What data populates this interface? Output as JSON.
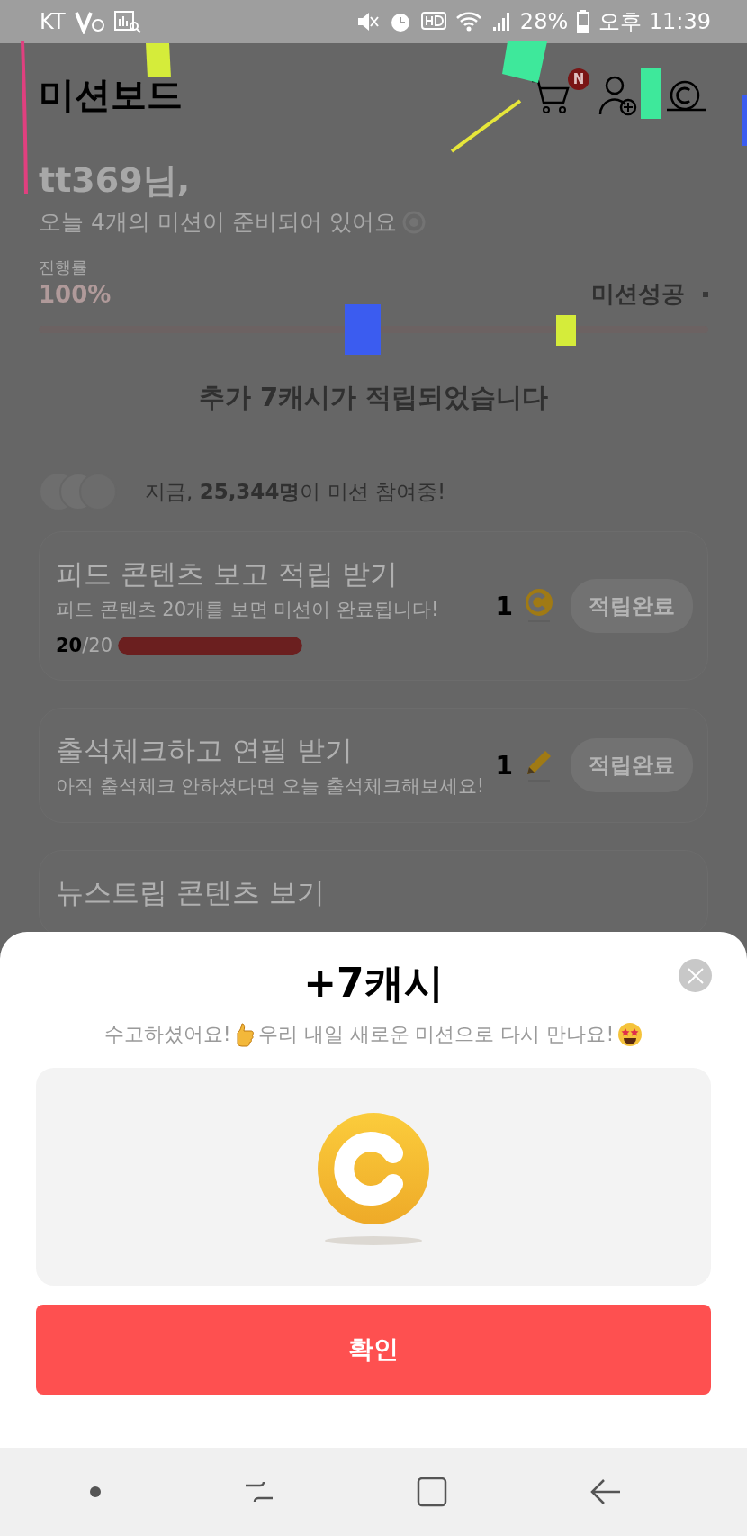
{
  "status_bar": {
    "carrier": "KT",
    "battery": "28%",
    "time": "오후 11:39"
  },
  "header": {
    "title": "미션보드",
    "cart_badge": "N"
  },
  "greeting": {
    "name": "tt369님,",
    "subtitle": "오늘 4개의 미션이 준비되어 있어요"
  },
  "progress": {
    "label": "진행률",
    "percent": "100%",
    "status": "미션성공",
    "level": 1
  },
  "notice": "추가 7캐시가 적립되었습니다",
  "participants": "지금, **25,344명**이 미션 참여중!",
  "missions": [
    {
      "title": "피드 콘텐츠 보고 적립 받기",
      "description": "피드 콘텐츠 20개를 보면 미션이 완료됩니다!",
      "reward": {
        "count": "1",
        "kind": "coin"
      },
      "button": "적립완료",
      "count": {
        "done": "20",
        "total": "/20",
        "level": 1
      }
    },
    {
      "title": "출석체크하고 연필 받기",
      "description": "아직 출석체크 안하셨다면 오늘 출석체크해보세요!",
      "reward": {
        "count": "1",
        "kind": "pencil"
      },
      "button": "적립완료"
    },
    {
      "title": "뉴스트립 콘텐츠 보기"
    }
  ],
  "sheet": {
    "title": "+7캐시",
    "message_start": "수고하셨어요!",
    "message_end": "우리 내일 새로운 미션으로 다시 만나요!",
    "confirm": "확인"
  }
}
